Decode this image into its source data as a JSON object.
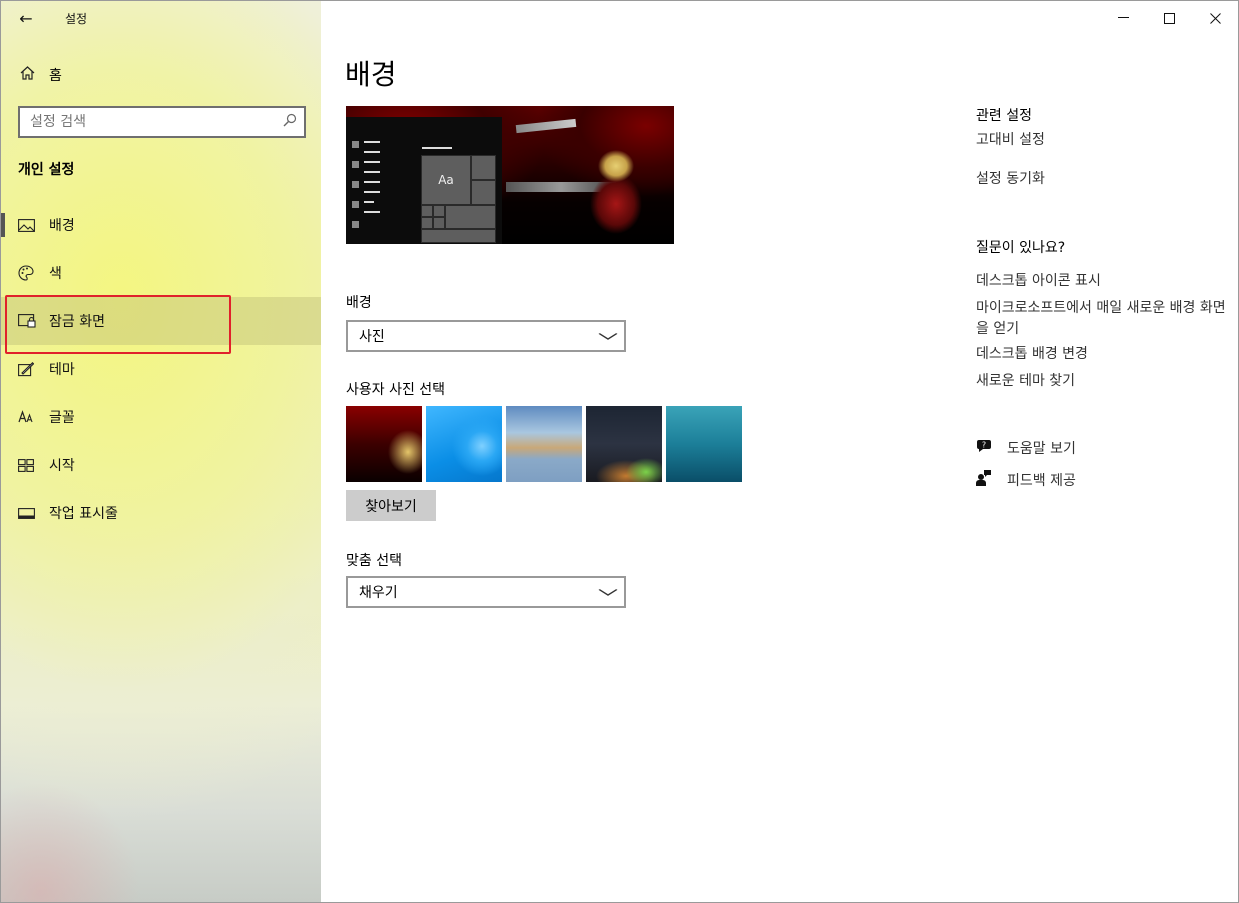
{
  "window": {
    "title": "설정",
    "back_icon": "←",
    "controls": {
      "minimize": "—",
      "maximize": "☐",
      "close": "✕"
    }
  },
  "sidebar": {
    "home_label": "홈",
    "search_placeholder": "설정 검색",
    "section_title": "개인 설정",
    "items": [
      {
        "label": "배경",
        "icon": "picture-icon",
        "selected": true
      },
      {
        "label": "색",
        "icon": "palette-icon"
      },
      {
        "label": "잠금 화면",
        "icon": "lock-screen-icon",
        "highlighted": true
      },
      {
        "label": "테마",
        "icon": "theme-icon"
      },
      {
        "label": "글꼴",
        "icon": "font-icon"
      },
      {
        "label": "시작",
        "icon": "start-icon"
      },
      {
        "label": "작업 표시줄",
        "icon": "taskbar-icon"
      }
    ]
  },
  "main": {
    "title": "배경",
    "preview_sample_text": "Aa",
    "background_label": "배경",
    "background_value": "사진",
    "choose_photo_label": "사용자 사진 선택",
    "browse_label": "찾아보기",
    "fit_label": "맞춤 선택",
    "fit_value": "채우기"
  },
  "right": {
    "related_title": "관련 설정",
    "related_links": [
      "고대비 설정",
      "설정 동기화"
    ],
    "questions_title": "질문이 있나요?",
    "question_links": [
      "데스크톱 아이콘 표시",
      "마이크로소프트에서 매일 새로운 배경 화면을 얻기",
      "데스크톱 배경 변경",
      "새로운 테마 찾기"
    ],
    "help_label": "도움말 보기",
    "feedback_label": "피드백 제공"
  },
  "colors": {
    "highlight_border": "#e0212b",
    "sidebar_yellow": "#f1f38f"
  }
}
